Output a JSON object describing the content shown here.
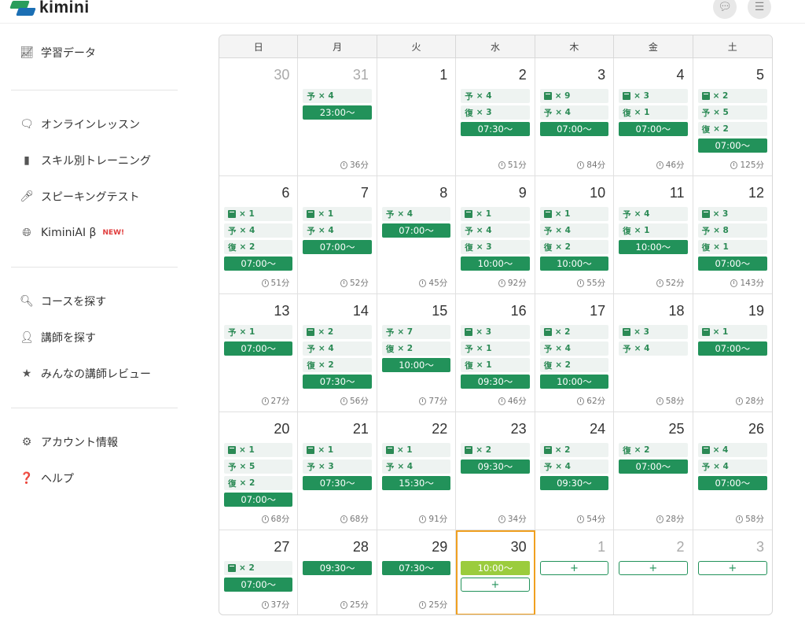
{
  "app": {
    "logo_text": "kimini"
  },
  "sidebar": {
    "groups": [
      [
        {
          "label": "学習データ",
          "icon": "chart-icon"
        }
      ],
      [
        {
          "label": "オンラインレッスン",
          "icon": "chat-icon"
        },
        {
          "label": "スキル別トレーニング",
          "icon": "book-icon"
        },
        {
          "label": "スピーキングテスト",
          "icon": "microphone-icon"
        },
        {
          "label": "KiminiAI β",
          "icon": "globe-icon",
          "badge": "NEW!"
        }
      ],
      [
        {
          "label": "コースを探す",
          "icon": "search-icon"
        },
        {
          "label": "講師を探す",
          "icon": "teacher-icon"
        },
        {
          "label": "みんなの講師レビュー",
          "icon": "star-icon"
        }
      ],
      [
        {
          "label": "アカウント情報",
          "icon": "gear-icon"
        },
        {
          "label": "ヘルプ",
          "icon": "help-icon"
        }
      ]
    ]
  },
  "calendar": {
    "weekdays": [
      "日",
      "月",
      "火",
      "水",
      "木",
      "金",
      "土"
    ],
    "days": [
      {
        "d": "30",
        "muted": true,
        "items": [],
        "dur": ""
      },
      {
        "d": "31",
        "muted": true,
        "items": [
          [
            "t",
            "予",
            "× 4"
          ],
          [
            "l",
            "23:00～"
          ]
        ],
        "dur": "36分"
      },
      {
        "d": "1",
        "items": [],
        "dur": ""
      },
      {
        "d": "2",
        "items": [
          [
            "t",
            "予",
            "× 4"
          ],
          [
            "t",
            "復",
            "× 3"
          ],
          [
            "l",
            "07:30～"
          ]
        ],
        "dur": "51分"
      },
      {
        "d": "3",
        "items": [
          [
            "b",
            "",
            "× 9"
          ],
          [
            "t",
            "予",
            "× 4"
          ],
          [
            "l",
            "07:00～"
          ]
        ],
        "dur": "84分"
      },
      {
        "d": "4",
        "items": [
          [
            "b",
            "",
            "× 3"
          ],
          [
            "t",
            "復",
            "× 1"
          ],
          [
            "l",
            "07:00～"
          ]
        ],
        "dur": "46分"
      },
      {
        "d": "5",
        "items": [
          [
            "b",
            "",
            "× 2"
          ],
          [
            "t",
            "予",
            "× 5"
          ],
          [
            "t",
            "復",
            "× 2"
          ],
          [
            "l",
            "07:00～"
          ]
        ],
        "dur": "125分"
      },
      {
        "d": "6",
        "items": [
          [
            "b",
            "",
            "× 1"
          ],
          [
            "t",
            "予",
            "× 4"
          ],
          [
            "t",
            "復",
            "× 2"
          ],
          [
            "l",
            "07:00～"
          ]
        ],
        "dur": "51分"
      },
      {
        "d": "7",
        "items": [
          [
            "b",
            "",
            "× 1"
          ],
          [
            "t",
            "予",
            "× 4"
          ],
          [
            "l",
            "07:00～"
          ]
        ],
        "dur": "52分"
      },
      {
        "d": "8",
        "items": [
          [
            "t",
            "予",
            "× 4"
          ],
          [
            "l",
            "07:00～"
          ]
        ],
        "dur": "45分"
      },
      {
        "d": "9",
        "items": [
          [
            "b",
            "",
            "× 1"
          ],
          [
            "t",
            "予",
            "× 4"
          ],
          [
            "t",
            "復",
            "× 3"
          ],
          [
            "l",
            "10:00～"
          ]
        ],
        "dur": "92分"
      },
      {
        "d": "10",
        "items": [
          [
            "b",
            "",
            "× 1"
          ],
          [
            "t",
            "予",
            "× 4"
          ],
          [
            "t",
            "復",
            "× 2"
          ],
          [
            "l",
            "10:00～"
          ]
        ],
        "dur": "55分"
      },
      {
        "d": "11",
        "items": [
          [
            "t",
            "予",
            "× 4"
          ],
          [
            "t",
            "復",
            "× 1"
          ],
          [
            "l",
            "10:00～"
          ]
        ],
        "dur": "52分"
      },
      {
        "d": "12",
        "items": [
          [
            "b",
            "",
            "× 3"
          ],
          [
            "t",
            "予",
            "× 8"
          ],
          [
            "t",
            "復",
            "× 1"
          ],
          [
            "l",
            "07:00～"
          ]
        ],
        "dur": "143分"
      },
      {
        "d": "13",
        "items": [
          [
            "t",
            "予",
            "× 1"
          ],
          [
            "l",
            "07:00～"
          ]
        ],
        "dur": "27分"
      },
      {
        "d": "14",
        "items": [
          [
            "b",
            "",
            "× 2"
          ],
          [
            "t",
            "予",
            "× 4"
          ],
          [
            "t",
            "復",
            "× 2"
          ],
          [
            "l",
            "07:30～"
          ]
        ],
        "dur": "56分"
      },
      {
        "d": "15",
        "items": [
          [
            "t",
            "予",
            "× 7"
          ],
          [
            "t",
            "復",
            "× 2"
          ],
          [
            "l",
            "10:00～"
          ]
        ],
        "dur": "77分"
      },
      {
        "d": "16",
        "items": [
          [
            "b",
            "",
            "× 3"
          ],
          [
            "t",
            "予",
            "× 1"
          ],
          [
            "t",
            "復",
            "× 1"
          ],
          [
            "l",
            "09:30～"
          ]
        ],
        "dur": "46分"
      },
      {
        "d": "17",
        "items": [
          [
            "b",
            "",
            "× 2"
          ],
          [
            "t",
            "予",
            "× 4"
          ],
          [
            "t",
            "復",
            "× 2"
          ],
          [
            "l",
            "10:00～"
          ]
        ],
        "dur": "62分"
      },
      {
        "d": "18",
        "items": [
          [
            "b",
            "",
            "× 3"
          ],
          [
            "t",
            "予",
            "× 4"
          ]
        ],
        "dur": "58分"
      },
      {
        "d": "19",
        "items": [
          [
            "b",
            "",
            "× 1"
          ],
          [
            "l",
            "07:00～"
          ]
        ],
        "dur": "28分"
      },
      {
        "d": "20",
        "items": [
          [
            "b",
            "",
            "× 1"
          ],
          [
            "t",
            "予",
            "× 5"
          ],
          [
            "t",
            "復",
            "× 2"
          ],
          [
            "l",
            "07:00～"
          ]
        ],
        "dur": "68分"
      },
      {
        "d": "21",
        "items": [
          [
            "b",
            "",
            "× 1"
          ],
          [
            "t",
            "予",
            "× 3"
          ],
          [
            "l",
            "07:30～"
          ]
        ],
        "dur": "68分"
      },
      {
        "d": "22",
        "items": [
          [
            "b",
            "",
            "× 1"
          ],
          [
            "t",
            "予",
            "× 4"
          ],
          [
            "l",
            "15:30～"
          ]
        ],
        "dur": "91分"
      },
      {
        "d": "23",
        "items": [
          [
            "b",
            "",
            "× 2"
          ],
          [
            "l",
            "09:30～"
          ]
        ],
        "dur": "34分"
      },
      {
        "d": "24",
        "items": [
          [
            "b",
            "",
            "× 2"
          ],
          [
            "t",
            "予",
            "× 4"
          ],
          [
            "l",
            "09:30～"
          ]
        ],
        "dur": "54分"
      },
      {
        "d": "25",
        "items": [
          [
            "t",
            "復",
            "× 2"
          ],
          [
            "l",
            "07:00～"
          ]
        ],
        "dur": "28分"
      },
      {
        "d": "26",
        "items": [
          [
            "b",
            "",
            "× 4"
          ],
          [
            "t",
            "予",
            "× 4"
          ],
          [
            "l",
            "07:00～"
          ]
        ],
        "dur": "58分"
      },
      {
        "d": "27",
        "items": [
          [
            "b",
            "",
            "× 2"
          ],
          [
            "l",
            "07:00～"
          ]
        ],
        "dur": "37分"
      },
      {
        "d": "28",
        "items": [
          [
            "l",
            "09:30～"
          ]
        ],
        "dur": "25分"
      },
      {
        "d": "29",
        "items": [
          [
            "l",
            "07:30～"
          ]
        ],
        "dur": "25分"
      },
      {
        "d": "30",
        "today": true,
        "items": [
          [
            "lime",
            "10:00～"
          ],
          [
            "p",
            "+"
          ]
        ],
        "dur": ""
      },
      {
        "d": "1",
        "muted": true,
        "items": [
          [
            "p",
            "+"
          ]
        ],
        "dur": ""
      },
      {
        "d": "2",
        "muted": true,
        "items": [
          [
            "p",
            "+"
          ]
        ],
        "dur": ""
      },
      {
        "d": "3",
        "muted": true,
        "items": [
          [
            "p",
            "+"
          ]
        ],
        "dur": ""
      }
    ]
  }
}
